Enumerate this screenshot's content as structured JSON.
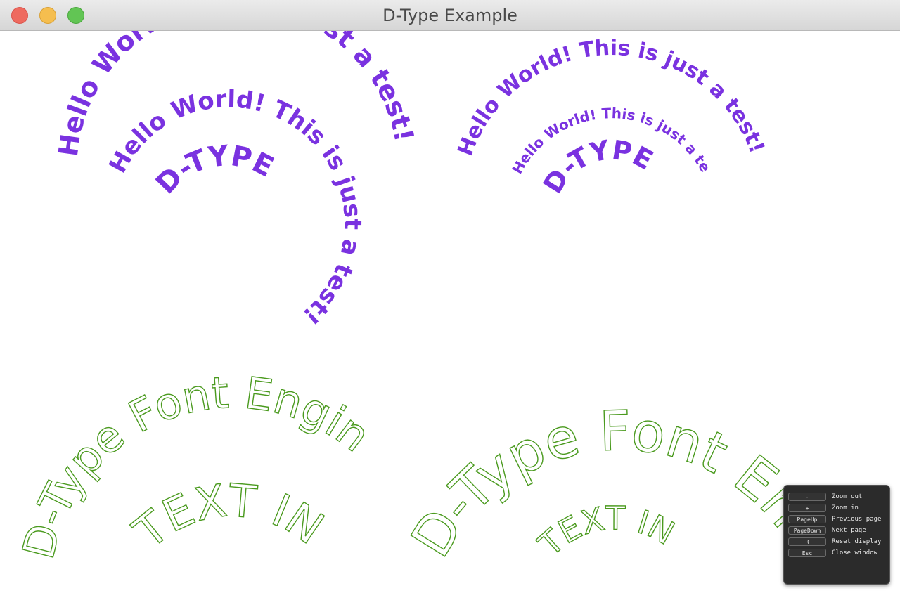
{
  "window": {
    "title": "D-Type Example"
  },
  "canvas": {
    "purple_color": "#7a32e0",
    "green_color": "#4a9a1e",
    "arcs": {
      "tl_outer": "Hello World! This is just a test!",
      "tl_middle": "Hello World! This is just a test!",
      "tl_inner": "D-TYPE",
      "tr_outer": "Hello World! This is just a test!",
      "tr_middle": "Hello World! This is just a test!",
      "tr_inner": "D-TYPE",
      "bl_outer": "D-Type Font Engine",
      "bl_inner": "TEXT IN ARC",
      "br_outer": "D-Type Font Engine",
      "br_inner": "TEXT IN ARC"
    }
  },
  "help": {
    "rows": [
      {
        "key": "-",
        "desc": "Zoom out"
      },
      {
        "key": "+",
        "desc": "Zoom in"
      },
      {
        "key": "PageUp",
        "desc": "Previous page"
      },
      {
        "key": "PageDown",
        "desc": "Next page"
      },
      {
        "key": "R",
        "desc": "Reset display"
      },
      {
        "key": "Esc",
        "desc": "Close window"
      }
    ]
  }
}
